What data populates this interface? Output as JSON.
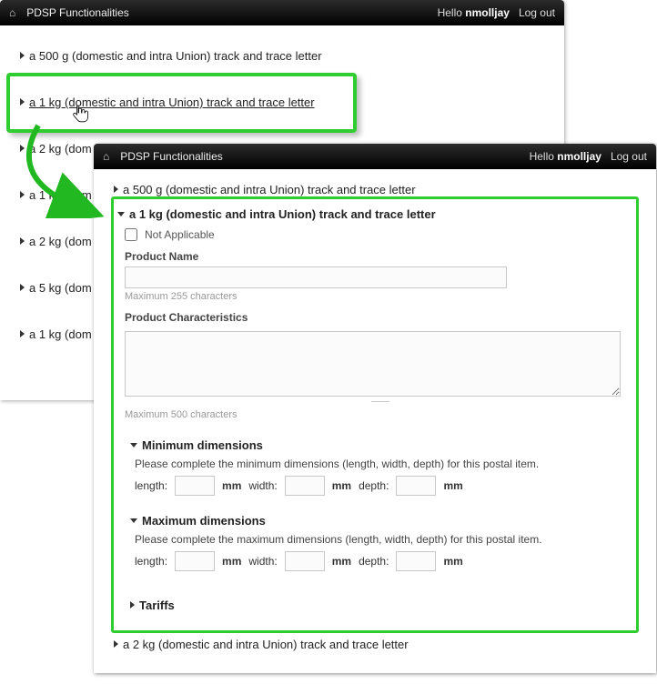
{
  "app": {
    "title": "PDSP Functionalities",
    "hello_prefix": "Hello",
    "username": "nmolljay",
    "logout": "Log out"
  },
  "back_items": [
    "a 500 g (domestic and intra Union) track and trace letter",
    "a 1 kg (domestic and intra Union) track and trace letter",
    "a 2 kg (dom",
    "a 1 kg (dom",
    "a 2 kg (dom",
    "a 5 kg (dom",
    "a 1 kg (dom"
  ],
  "front": {
    "top_item": "a 500 g (domestic and intra Union) track and trace letter",
    "expanded_title": "a 1 kg (domestic and intra Union) track and trace letter",
    "not_applicable": "Not Applicable",
    "product_name_label": "Product Name",
    "product_name_hint": "Maximum 255 characters",
    "product_char_label": "Product Characteristics",
    "product_char_hint": "Maximum 500 characters",
    "min_dim": {
      "title": "Minimum dimensions",
      "instr": "Please complete the minimum dimensions (length, width, depth) for this postal item.",
      "length": "length:",
      "width": "width:",
      "depth": "depth:",
      "unit": "mm"
    },
    "max_dim": {
      "title": "Maximum dimensions",
      "instr": "Please complete the maximum dimensions (length, width, depth) for this postal item.",
      "length": "length:",
      "width": "width:",
      "depth": "depth:",
      "unit": "mm"
    },
    "tariffs": "Tariffs",
    "bottom_item": "a 2 kg (domestic and intra Union) track and trace letter"
  }
}
